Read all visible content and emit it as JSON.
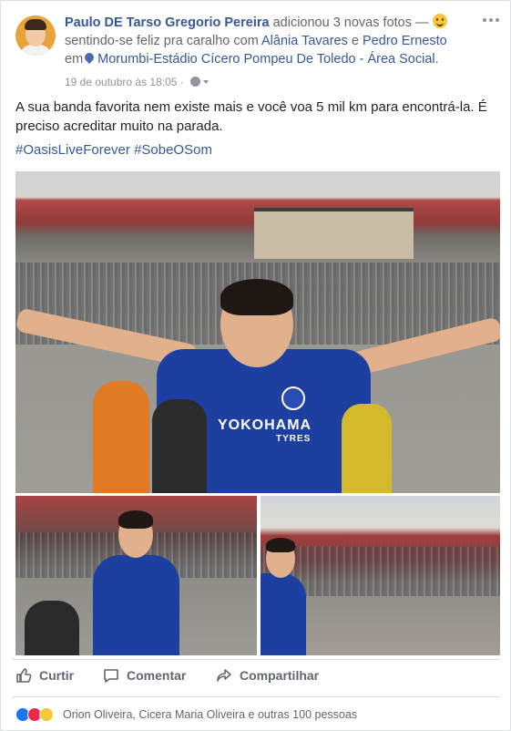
{
  "post": {
    "author": "Paulo DE Tarso Gregorio Pereira",
    "action": "adicionou 3 novas fotos —",
    "feeling_prefix": "sentindo-se feliz pra caralho com",
    "tagged_1": "Alânia Tavares",
    "conj": "e",
    "tagged_2": "Pedro Ernesto",
    "location_prefix": "em",
    "location": "Morumbi-Estádio Cícero Pompeu De Toledo - Área Social",
    "location_suffix": ".",
    "timestamp": "19 de outubro às 18:05",
    "timestamp_sep": "·",
    "text": "A sua banda favorita nem existe mais e você voa 5 mil km para encontrá-la. É preciso acreditar muito na parada.",
    "hashtag_1": "#OasisLiveForever",
    "hashtag_2": "#SobeOSom"
  },
  "photos": {
    "jersey_text": "YOKOHAMA",
    "jersey_sub": "TYRES"
  },
  "actions": {
    "like": "Curtir",
    "comment": "Comentar",
    "share": "Compartilhar"
  },
  "reactions": {
    "summary": "Orion Oliveira, Cicera Maria Oliveira e outras 100 pessoas"
  },
  "icons": {
    "menu": "more-icon",
    "feeling": "smile-emoji-icon",
    "location": "location-pin-icon",
    "privacy": "globe-icon",
    "like": "thumb-up-icon",
    "comment": "comment-bubble-icon",
    "share": "share-arrow-icon"
  },
  "colors": {
    "link": "#365899",
    "meta": "#90949c",
    "like_reaction": "#1877f2",
    "love_reaction": "#f0284a",
    "wow_reaction": "#f7c737"
  }
}
